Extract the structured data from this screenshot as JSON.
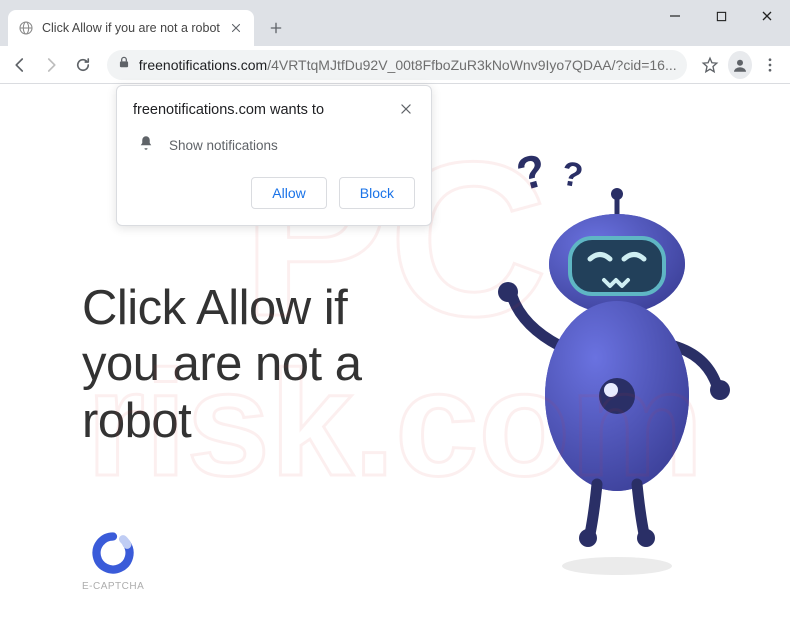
{
  "tab": {
    "title": "Click Allow if you are not a robot"
  },
  "url": {
    "domain": "freenotifications.com",
    "path": "/4VRTtqMJtfDu92V_00t8FfboZuR3kNoWnv9Iyo7QDAA/?cid=16..."
  },
  "permission": {
    "origin_wants_to": "freenotifications.com wants to",
    "capability": "Show notifications",
    "allow": "Allow",
    "block": "Block"
  },
  "page": {
    "headline_line1": "Click Allow if",
    "headline_line2": "you are not a",
    "headline_line3": "robot",
    "captcha_label": "E-CAPTCHA"
  },
  "watermark": {
    "line1": "PC",
    "line2": "risk.com"
  }
}
